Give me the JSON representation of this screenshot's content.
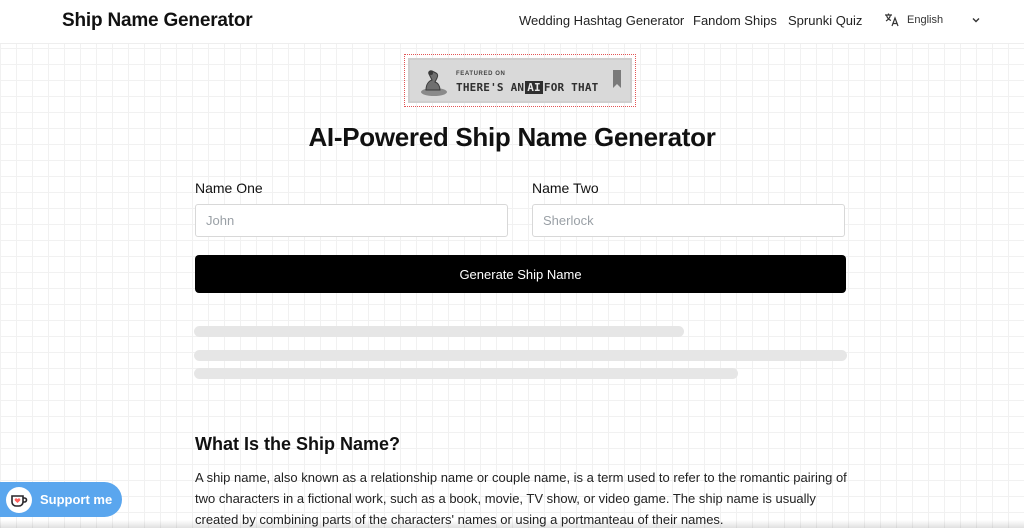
{
  "header": {
    "brand": "Ship Name Generator",
    "nav": [
      "Wedding Hashtag Generator",
      "Fandom Ships",
      "Sprunki Quiz"
    ],
    "language": "English"
  },
  "badge": {
    "featured": "FEATURED ON",
    "text_before": "THERE'S AN",
    "text_ai": "AI",
    "text_after": "FOR THAT"
  },
  "main": {
    "title": "AI-Powered Ship Name Generator",
    "name_one_label": "Name One",
    "name_one_placeholder": "John",
    "name_two_label": "Name Two",
    "name_two_placeholder": "Sherlock",
    "generate_label": "Generate Ship Name"
  },
  "info": {
    "heading": "What Is the Ship Name?",
    "body": "A ship name, also known as a relationship name or couple name, is a term used to refer to the romantic pairing of two characters in a fictional work, such as a book, movie, TV show, or video game. The ship name is usually created by combining parts of the characters' names or using a portmanteau of their names."
  },
  "support": {
    "label": "Support me",
    "color": "#5aa6ee"
  }
}
